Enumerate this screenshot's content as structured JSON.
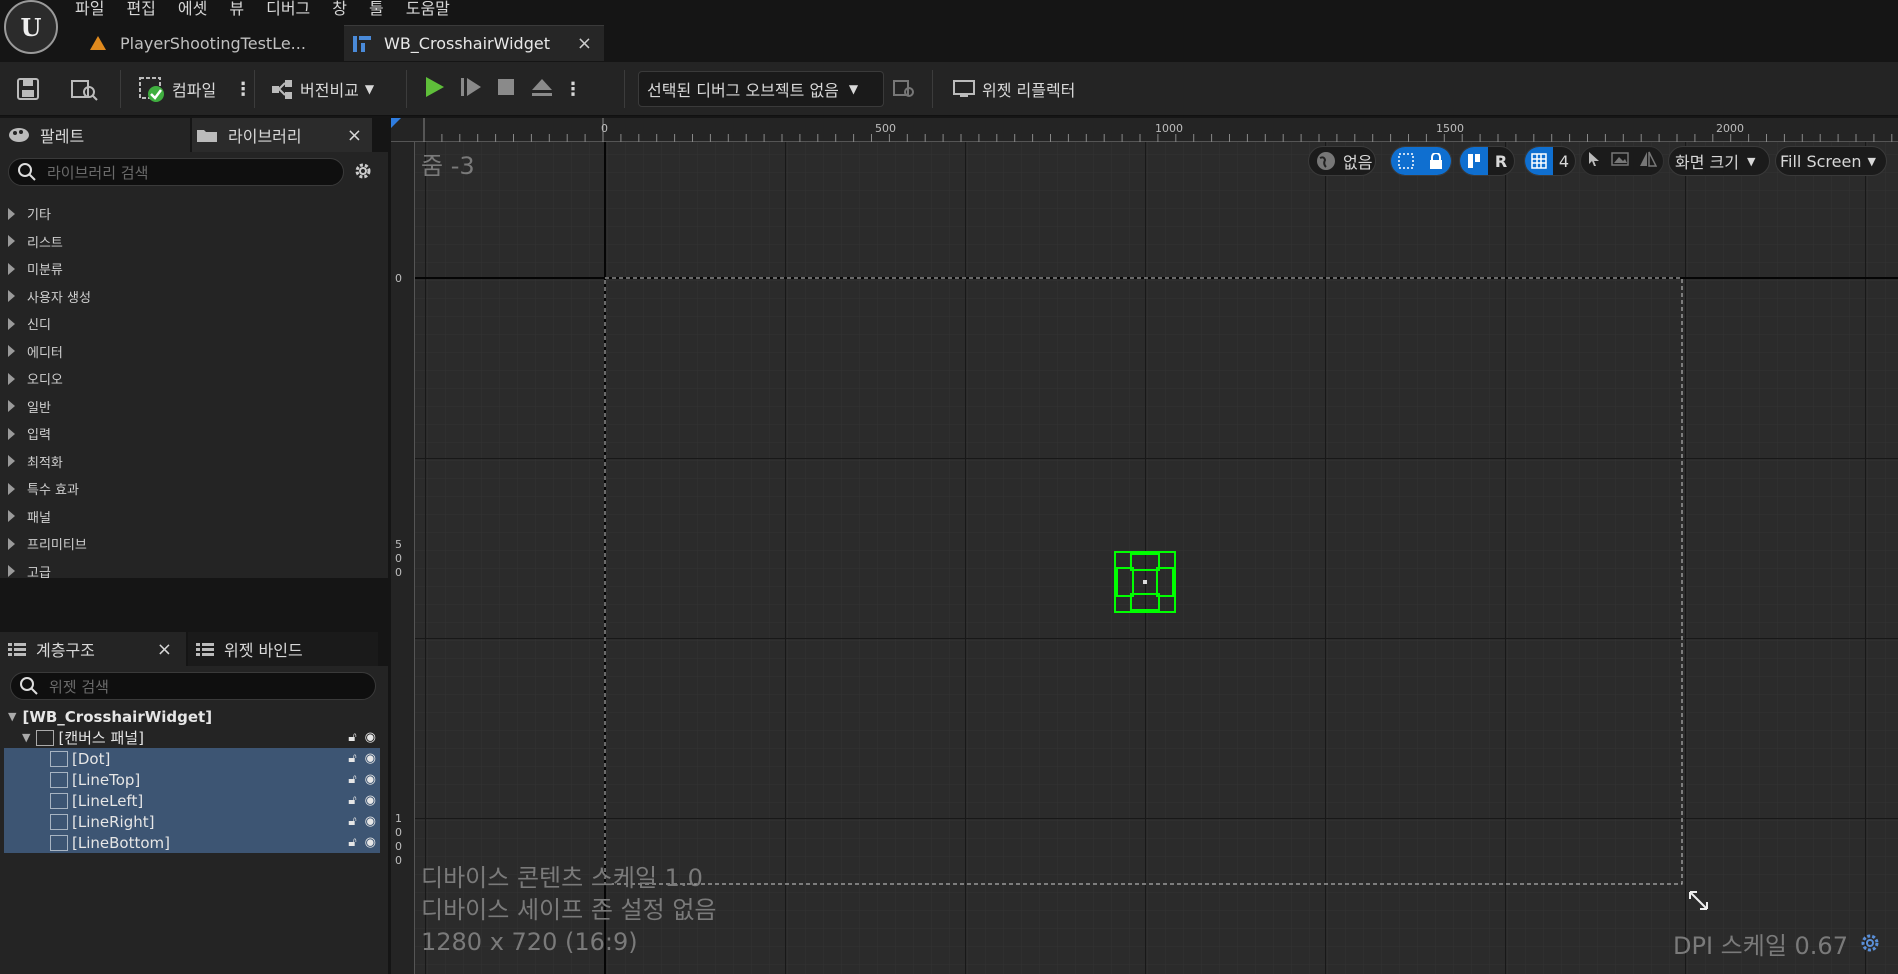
{
  "menu": [
    "파일",
    "편집",
    "에셋",
    "뷰",
    "디버그",
    "창",
    "툴",
    "도움말"
  ],
  "tabs": [
    {
      "label": "PlayerShootingTestLe...",
      "icon": "level-icon"
    },
    {
      "label": "WB_CrosshairWidget",
      "icon": "widget-blueprint-icon",
      "close": "×"
    }
  ],
  "toolbar": {
    "compile_label": "컴파일",
    "diff_label": "버전비교",
    "debug_object": "선택된 디버그 오브젝트 없음",
    "widget_reflector": "위젯 리플렉터"
  },
  "palette": {
    "tab_label": "팔레트",
    "library_tab": "라이브러리",
    "close": "×",
    "search_placeholder": "라이브러리 검색",
    "categories": [
      "기타",
      "리스트",
      "미분류",
      "사용자 생성",
      "신디",
      "에디터",
      "오디오",
      "일반",
      "입력",
      "최적화",
      "특수 효과",
      "패널",
      "프리미티브",
      "고급"
    ]
  },
  "hierarchy": {
    "tab_label": "계층구조",
    "close": "×",
    "bindings_tab": "위젯 바인드",
    "search_placeholder": "위젯 검색",
    "root": "[WB_CrosshairWidget]",
    "canvas": "[캔버스 패널]",
    "items": [
      "[Dot]",
      "[LineTop]",
      "[LineLeft]",
      "[LineRight]",
      "[LineBottom]"
    ]
  },
  "canvas": {
    "zoom": "줌 -3",
    "localization": "없음",
    "snap_r": "R",
    "grid_value": "4",
    "screen_size": "화면 크기",
    "fill_mode": "Fill Screen",
    "device_scale": "디바이스 콘텐츠 스케일 1.0",
    "safe_zone": "디바이스 세이프 존 설정 없음",
    "resolution": "1280 x 720 (16:9)",
    "dpi": "DPI 스케일 0.67",
    "ruler_top": [
      "0",
      "500",
      "1000",
      "1500",
      "2000"
    ],
    "ruler_left": [
      "0",
      "500",
      "1000"
    ]
  },
  "colors": {
    "accent": "#0f6fd0",
    "selection": "#3d5573",
    "widget_outline": "#00ff00",
    "play": "#5fbf3a"
  }
}
